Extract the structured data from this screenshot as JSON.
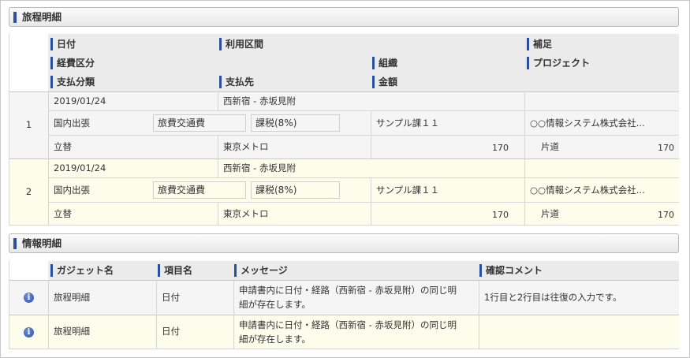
{
  "sections": {
    "travel": "旅程明細",
    "info": "情報明細"
  },
  "travel_headers": {
    "date": "日付",
    "route": "利用区間",
    "note": "補足",
    "expense_category": "経費区分",
    "organization": "組織",
    "project": "プロジェクト",
    "payment_type": "支払分類",
    "payee": "支払先",
    "amount": "金額"
  },
  "travel_rows": [
    {
      "no": "1",
      "date": "2019/01/24",
      "route": "西新宿 - 赤坂見附",
      "note": "",
      "category": "国内出張",
      "subcategory": "旅費交通費",
      "tax": "課税(8%)",
      "organization": "サンプル課１１",
      "project": "○○情報システム株式会社...",
      "payment": "立替",
      "payee": "東京メトロ",
      "amount": "170",
      "trip": "片道",
      "trip_amount": "170"
    },
    {
      "no": "2",
      "date": "2019/01/24",
      "route": "西新宿 - 赤坂見附",
      "note": "",
      "category": "国内出張",
      "subcategory": "旅費交通費",
      "tax": "課税(8%)",
      "organization": "サンプル課１１",
      "project": "○○情報システム株式会社...",
      "payment": "立替",
      "payee": "東京メトロ",
      "amount": "170",
      "trip": "片道",
      "trip_amount": "170"
    }
  ],
  "info_headers": {
    "gadget": "ガジェット名",
    "item": "項目名",
    "message": "メッセージ",
    "comment": "確認コメント"
  },
  "info_rows": [
    {
      "gadget": "旅程明細",
      "item": "日付",
      "message_line1": "申請書内に日付・経路（西新宿 - 赤坂見附）の同じ明",
      "message_line2": "細が存在します。",
      "comment": "1行目と2行目は往復の入力です。"
    },
    {
      "gadget": "旅程明細",
      "item": "日付",
      "message_line1": "申請書内に日付・経路（西新宿 - 赤坂見附）の同じ明",
      "message_line2": "細が存在します。",
      "comment": ""
    }
  ],
  "colors": {
    "accent": "#2a4f9e",
    "row_odd": "#f5f5f5",
    "row_even": "#fdfdec",
    "header": "#ebebeb"
  }
}
